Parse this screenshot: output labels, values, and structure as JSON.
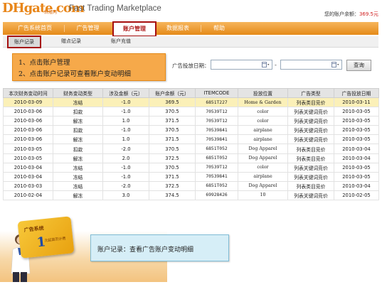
{
  "header": {
    "logo_main": "DHgate.com",
    "logo_sub": "敦煌网",
    "tagline": "Fast Trading Marketplace",
    "balance_label": "您的账户余额：",
    "balance_value": "369.5元"
  },
  "nav": {
    "items": [
      "广告系统首页",
      "广告管理",
      "账户管理",
      "数据报表",
      "帮助"
    ],
    "active_index": 2
  },
  "subnav": {
    "items": [
      "账户记录",
      "赠点记录",
      "账户充值"
    ],
    "active_index": 0
  },
  "instruction": {
    "line1": "1、点击账户管理",
    "line2": "2、点击账户记录可查看账户变动明细"
  },
  "filter": {
    "date_label": "广告投放日期：",
    "start_value": "",
    "end_value": "",
    "separator": "-",
    "query_label": "查询"
  },
  "table": {
    "headers": [
      "本次财务变动时间",
      "财务变动类型",
      "涉及金额（元）",
      "账户余额（元）",
      "ITEMCODE",
      "投放位置",
      "广告类型",
      "广告投放日期"
    ],
    "rows": [
      [
        "2010-03-09",
        "冻结",
        "-1.0",
        "369.5",
        "6851T227",
        "Home & Garden",
        "列表类目竞价",
        "2010-03-11"
      ],
      [
        "2010-03-06",
        "扣款",
        "-1.0",
        "370.5",
        "70539T12",
        "color",
        "列表关键词竞价",
        "2010-03-05"
      ],
      [
        "2010-03-06",
        "解冻",
        "1.0",
        "371.5",
        "70539T12",
        "color",
        "列表关键词竞价",
        "2010-03-05"
      ],
      [
        "2010-03-06",
        "扣款",
        "-1.0",
        "370.5",
        "70539841",
        "airplane",
        "列表关键词竞价",
        "2010-03-05"
      ],
      [
        "2010-03-06",
        "解冻",
        "1.0",
        "371.5",
        "70539841",
        "airplane",
        "列表关键词竞价",
        "2010-03-05"
      ],
      [
        "2010-03-05",
        "扣款",
        "-2.0",
        "370.5",
        "6851T052",
        "Dog Apparel",
        "列表类目竞价",
        "2010-03-04"
      ],
      [
        "2010-03-05",
        "解冻",
        "2.0",
        "372.5",
        "6851T052",
        "Dog Apparel",
        "列表类目竞价",
        "2010-03-04"
      ],
      [
        "2010-03-04",
        "冻结",
        "-1.0",
        "370.5",
        "70539T12",
        "color",
        "列表关键词竞价",
        "2010-03-05"
      ],
      [
        "2010-03-04",
        "冻结",
        "-1.0",
        "371.5",
        "70539841",
        "airplane",
        "列表关键词竞价",
        "2010-03-05"
      ],
      [
        "2010-03-03",
        "冻结",
        "-2.0",
        "372.5",
        "6851T052",
        "Dog Apparel",
        "列表类目竞价",
        "2010-03-04"
      ],
      [
        "2010-02-04",
        "解冻",
        "3.0",
        "374.5",
        "69928426",
        "10",
        "列表关键词竞价",
        "2010-02-05"
      ]
    ],
    "highlight_row": 0
  },
  "promo": {
    "card_title": "广告系统",
    "card_number": "1",
    "card_tag": "元起首页计费",
    "note": "账户记录：查看广告账户变动明细"
  },
  "colors": {
    "accent_orange": "#e58a18",
    "active_border": "#a60f0f",
    "balance_red": "#d02020",
    "highlight_row": "#fbf0b8",
    "note_bg": "#d6eef7"
  }
}
